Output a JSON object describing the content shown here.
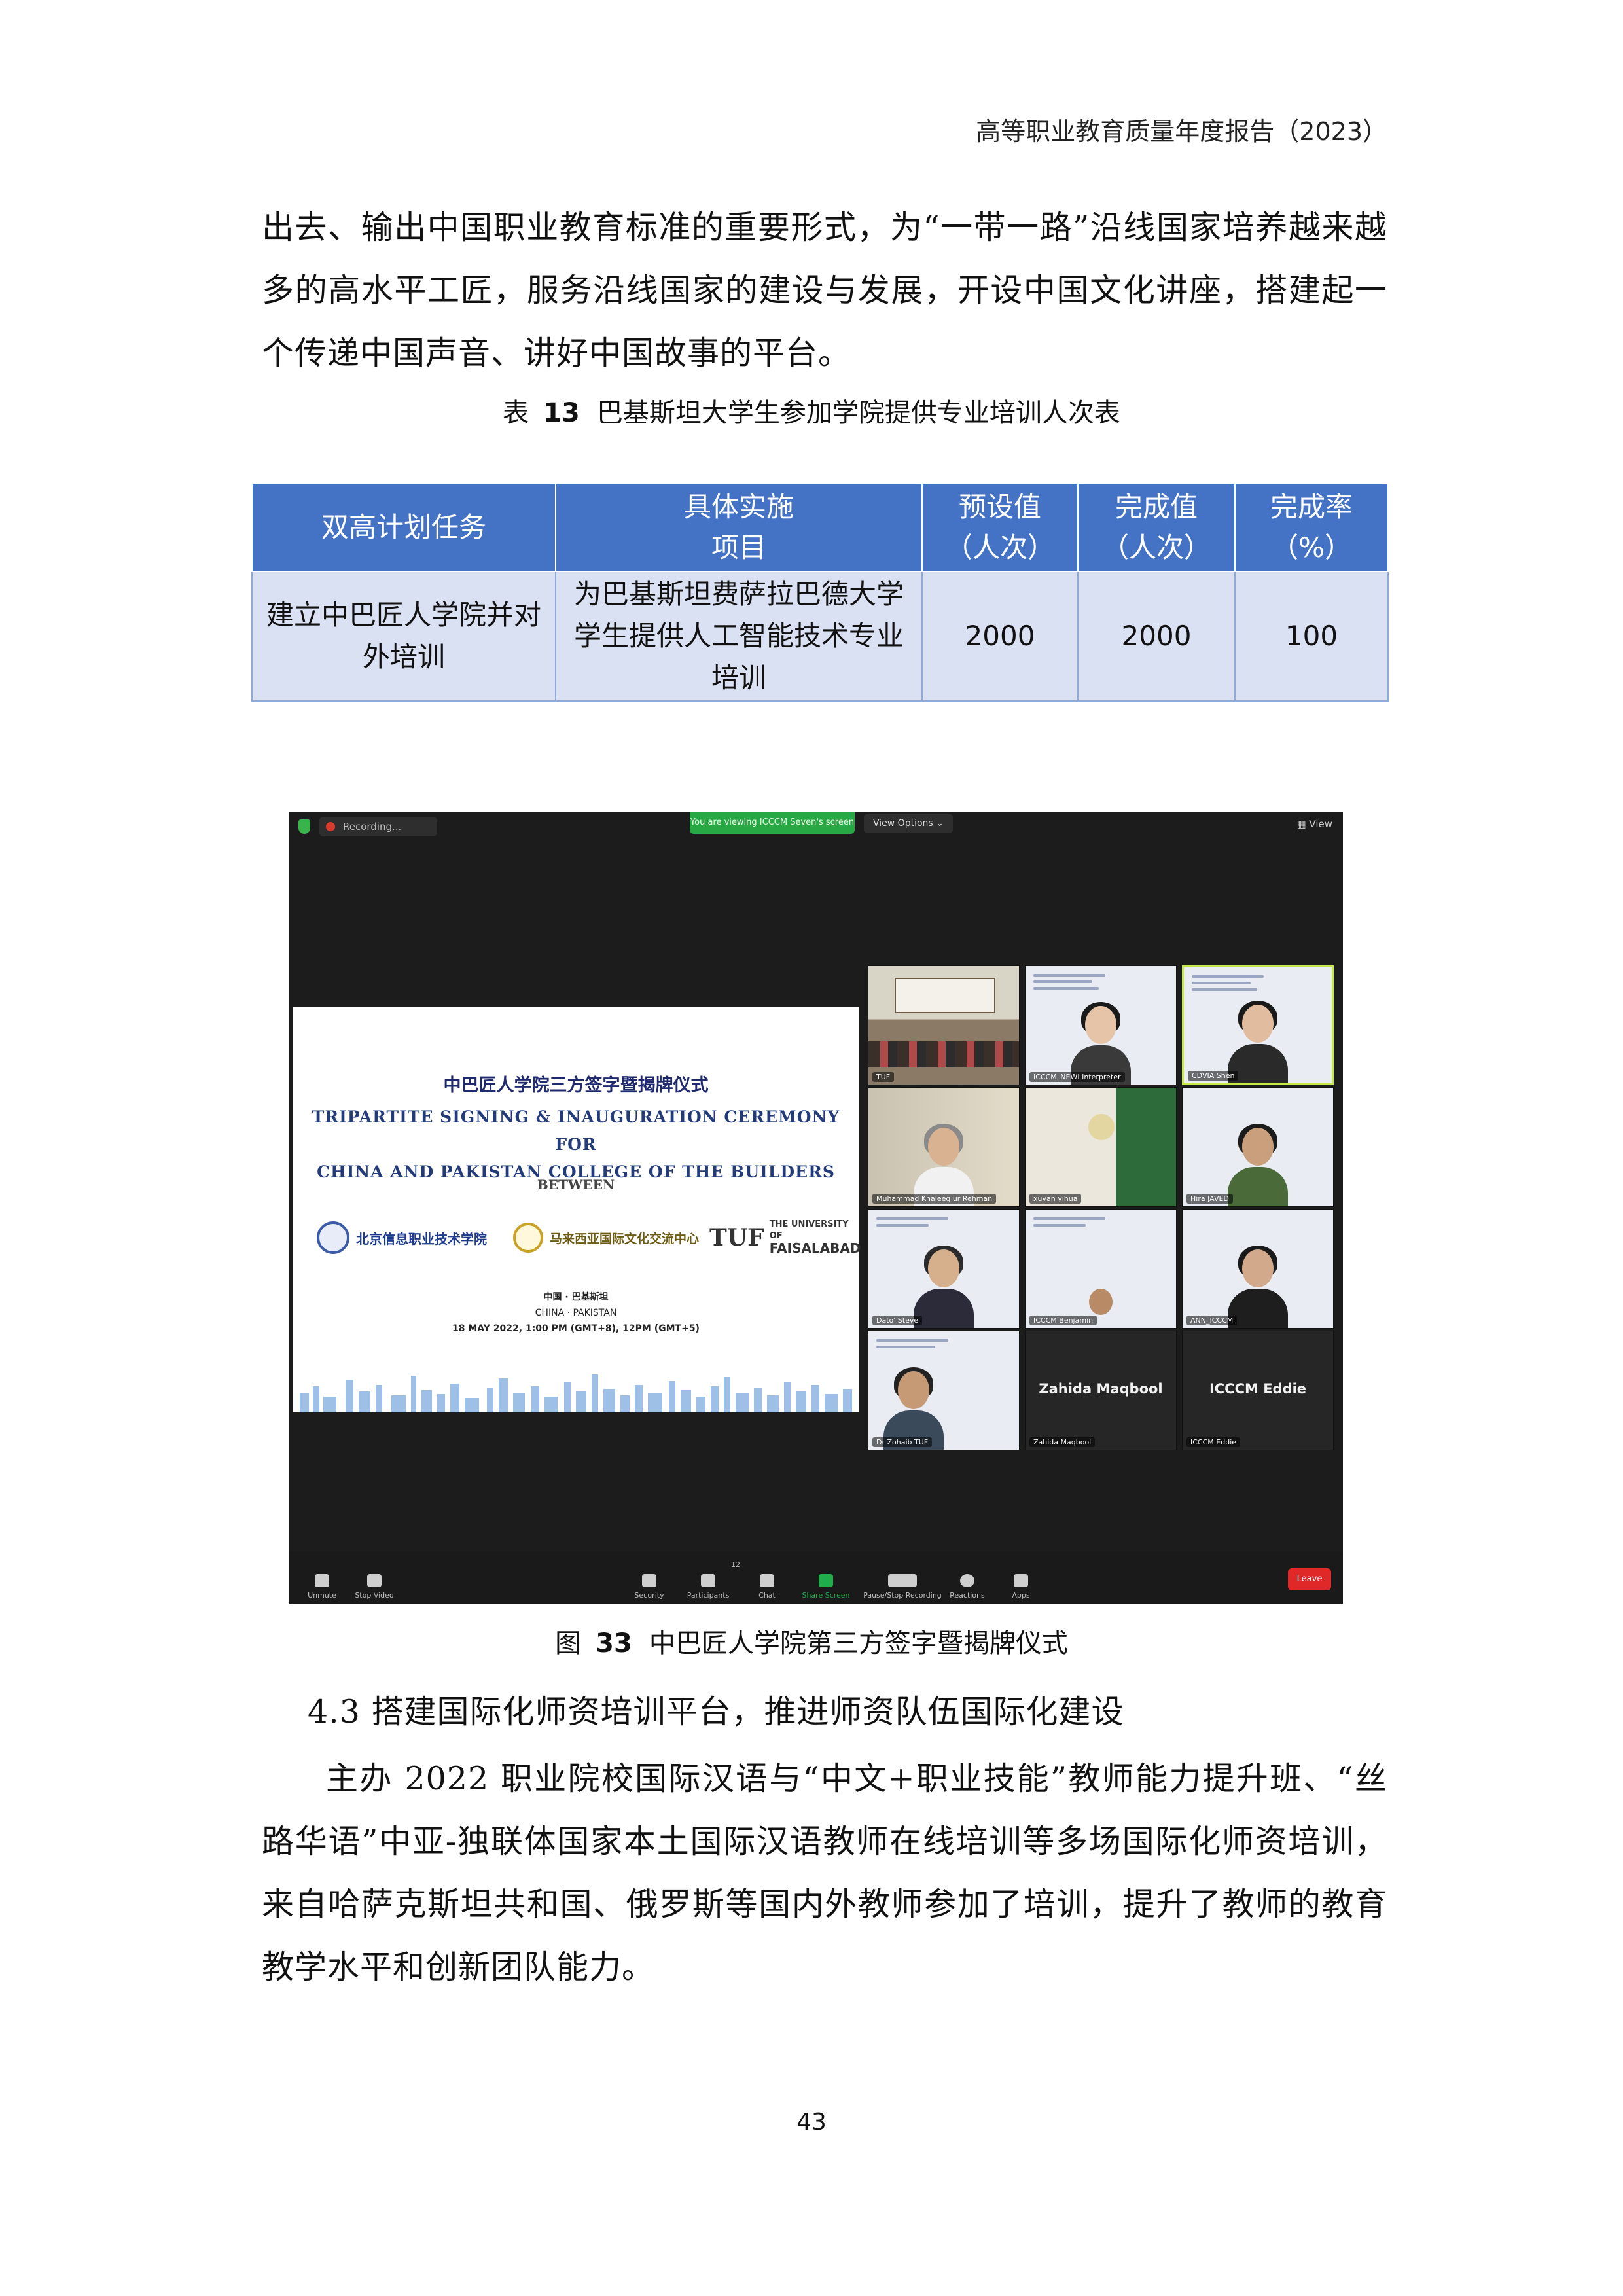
{
  "header": {
    "running_title": "高等职业教育质量年度报告（2023）"
  },
  "intro_paragraph": "出去、输出中国职业教育标准的重要形式，为“一带一路”沿线国家培养越来越多的高水平工匠，服务沿线国家的建设与发展，开设中国文化讲座，搭建起一个传递中国声音、讲好中国故事的平台。",
  "table_caption": {
    "prefix": "表",
    "number": "13",
    "title": "巴基斯坦大学生参加学院提供专业培训人次表"
  },
  "table": {
    "headers": [
      [
        "双高计划任务"
      ],
      [
        "具体实施",
        "项目"
      ],
      [
        "预设值",
        "（人次）"
      ],
      [
        "完成值",
        "（人次）"
      ],
      [
        "完成率",
        "（%）"
      ]
    ],
    "rows": [
      [
        "建立中巴匠人学院并对外培训",
        "为巴基斯坦费萨拉巴德大学学生提供人工智能技术专业培训",
        "2000",
        "2000",
        "100"
      ]
    ]
  },
  "figure": {
    "topbar": {
      "recording": "Recording...",
      "share_banner": "You are viewing ICCCM Seven's screen",
      "view_options": "View Options ⌄",
      "view": "View"
    },
    "slide": {
      "title_cn": "中巴匠人学院三方签字暨揭牌仪式",
      "title_en_1": "TRIPARTITE SIGNING & INAUGURATION CEREMONY FOR",
      "title_en_2": "CHINA AND PAKISTAN COLLEGE OF THE BUILDERS",
      "between": "BETWEEN",
      "logo_1": "北京信息职业技术学院",
      "logo_2": "马来西亚国际文化交流中心",
      "logo_3_mark": "TUF",
      "logo_3_line1": "THE UNIVERSITY OF",
      "logo_3_line2": "FAISALABAD",
      "location_cn": "中国 · 巴基斯坦",
      "location_en": "CHINA · PAKISTAN",
      "datetime": "18 MAY 2022, 1:00 PM (GMT+8), 12PM (GMT+5)"
    },
    "participants": [
      "TUF",
      "ICCCM_NEWI Interpreter",
      "CDVIA Shen",
      "Muhammad Khaleeq ur Rehman",
      "xuyan yihua",
      "Hira JAVED",
      "Dato' Steve",
      "ICCCM Benjamin",
      "ANN_ICCCM",
      "Dr Zohaib TUF",
      "Zahida Maqbool",
      "ICCCM Eddie"
    ],
    "toolbar": [
      "Unmute",
      "Stop Video",
      "Security",
      "Participants",
      "Chat",
      "Share Screen",
      "Pause/Stop Recording",
      "Reactions",
      "Apps"
    ],
    "participants_count": "12",
    "leave": "Leave"
  },
  "figure_caption": {
    "prefix": "图",
    "number": "33",
    "title": "中巴匠人学院第三方签字暨揭牌仪式"
  },
  "section": {
    "number": "4.3",
    "title": "搭建国际化师资培训平台，推进师资队伍国际化建设"
  },
  "section_paragraph": "主办 2022 职业院校国际汉语与“中文+职业技能”教师能力提升班、“丝路华语”中亚-独联体国家本土国际汉语教师在线培训等多场国际化师资培训，来自哈萨克斯坦共和国、俄罗斯等国内外教师参加了培训，提升了教师的教育教学水平和创新团队能力。",
  "page_number": "43",
  "colors": {
    "table_header": "#4472c4",
    "table_row": "#d9e1f2",
    "share_green": "#28a745",
    "leave_red": "#e02828"
  }
}
